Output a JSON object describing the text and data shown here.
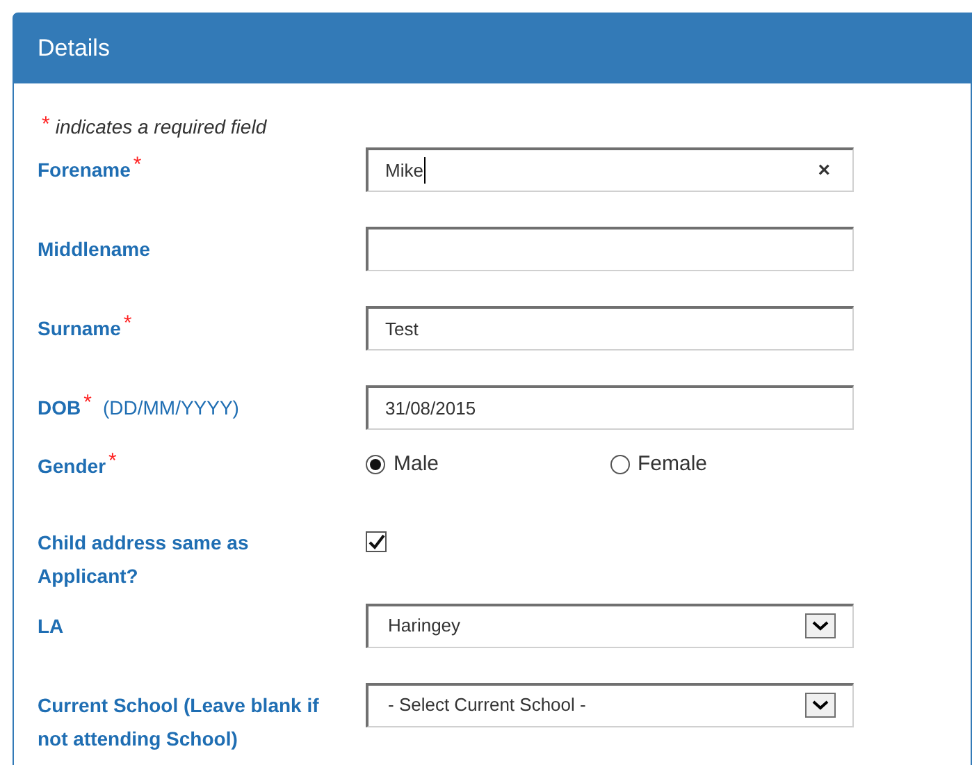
{
  "panel": {
    "title": "Details"
  },
  "required_note": {
    "marker": "*",
    "text": "indicates a required field"
  },
  "fields": [
    {
      "kind": "text",
      "label": "Forename",
      "required_marker": "*",
      "value": "Mike",
      "focused": true,
      "clear_button": "×"
    },
    {
      "kind": "text",
      "label": "Middlename"
    },
    {
      "kind": "text",
      "label": "Surname",
      "required_marker": "*",
      "value": "Test"
    },
    {
      "kind": "text",
      "label": "DOB",
      "required_marker": "*",
      "hint": "(DD/MM/YYYY)",
      "value": "31/08/2015"
    },
    {
      "kind": "radio",
      "label": "Gender",
      "required_marker": "*",
      "options": [
        {
          "label": "Male",
          "selected": true
        },
        {
          "label": "Female",
          "selected": false
        }
      ]
    },
    {
      "kind": "checkbox",
      "label": "Child address same as Applicant?",
      "checked": true
    },
    {
      "kind": "select",
      "label": "LA",
      "value": "Haringey"
    },
    {
      "kind": "select",
      "label": "Current School (Leave blank if not attending School)",
      "value": "- Select Current School -"
    }
  ]
}
